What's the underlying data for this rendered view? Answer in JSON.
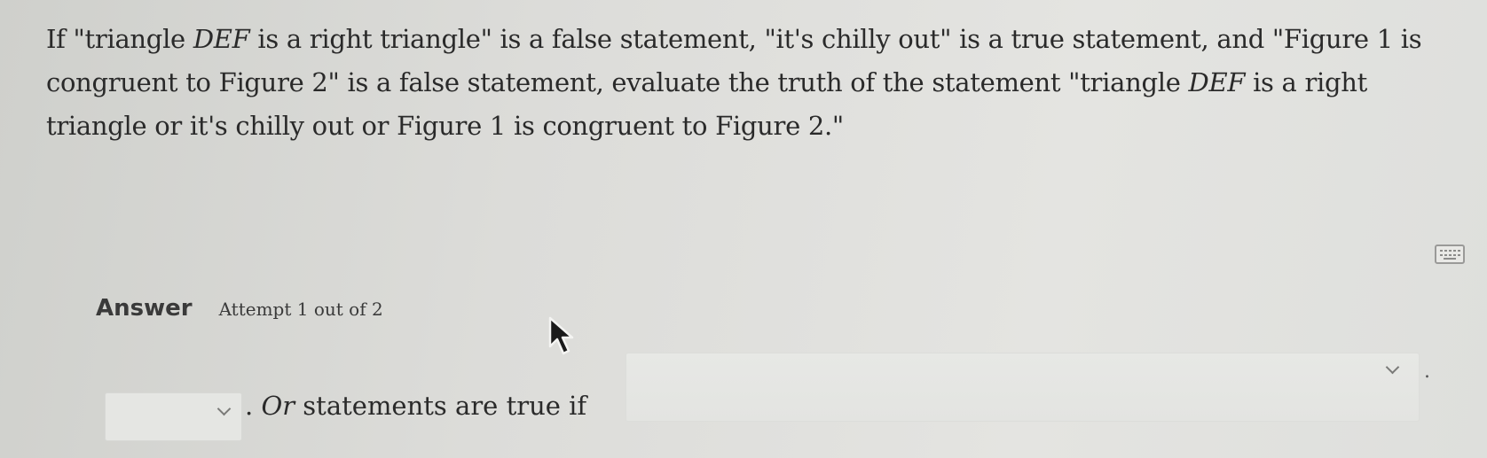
{
  "question": {
    "part1": "If \"triangle ",
    "math1": "DEF",
    "part2": " is a right triangle\" is a false statement, \"it's chilly out\" is a true statement, and \"Figure 1 is congruent to Figure 2\" is a false statement, evaluate the truth of the statement \"triangle ",
    "math2": "DEF",
    "part3": " is a right triangle or it's chilly out or Figure 1 is congruent to Figure 2.\""
  },
  "answer": {
    "label": "Answer",
    "attempt": "Attempt 1 out of 2"
  },
  "response": {
    "dropdown_left_value": "",
    "prefix": ". ",
    "or_word": "Or",
    "sentence": " statements are true if",
    "dropdown_right_value": "",
    "trailing": "."
  },
  "icons": {
    "keyboard": "keyboard-icon",
    "cursor": "mouse-pointer-icon",
    "chevron": "chevron-down-icon"
  }
}
